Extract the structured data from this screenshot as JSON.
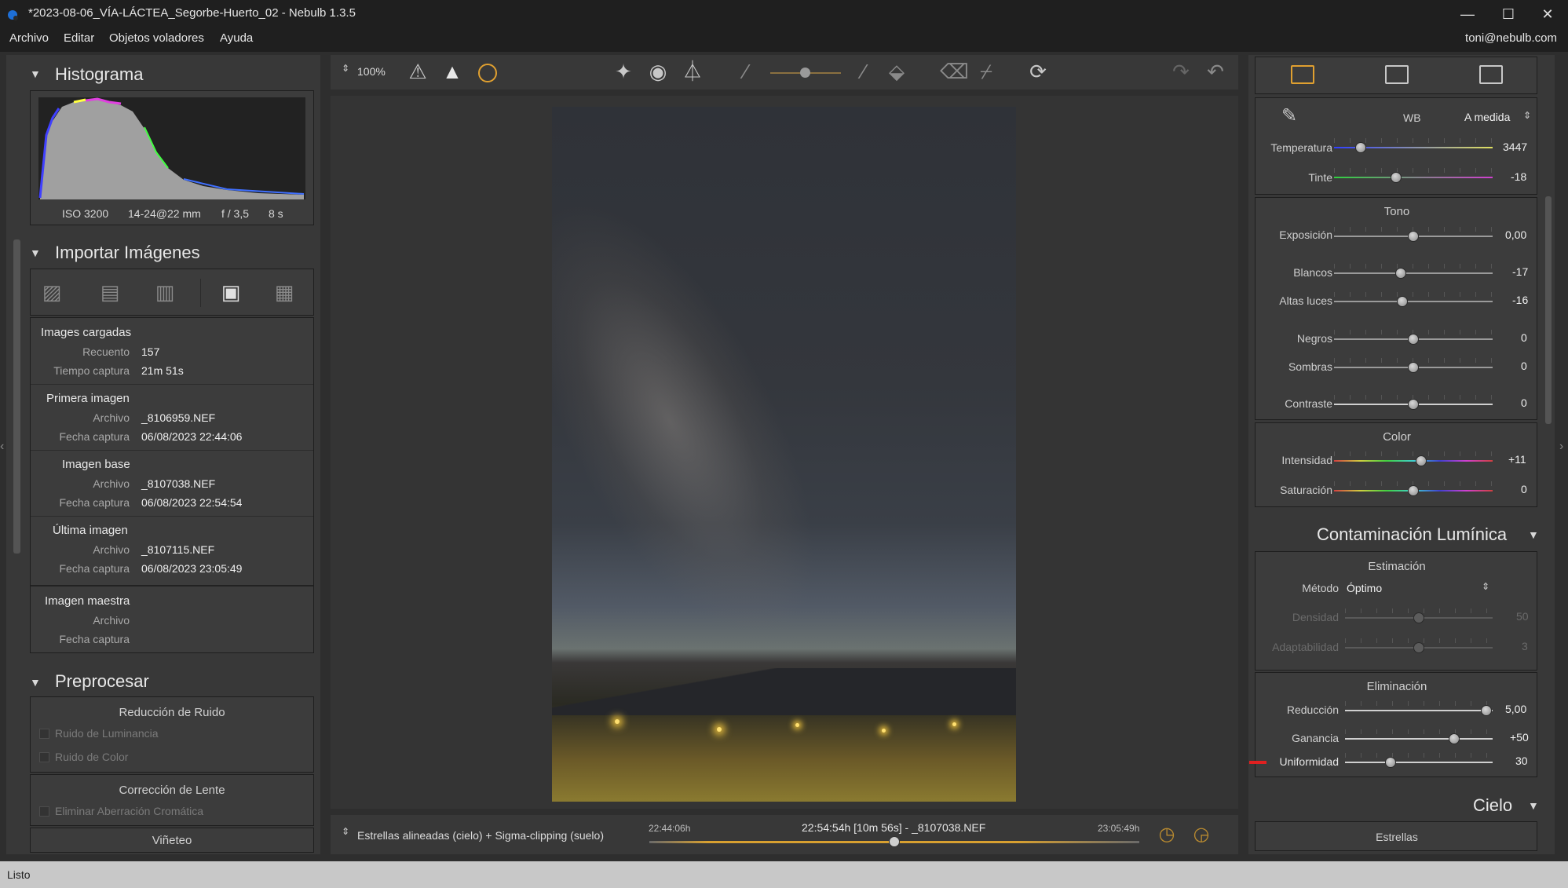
{
  "window": {
    "title": "*2023-08-06_VÍA-LÁCTEA_Segorbe-Huerto_02 - Nebulb 1.3.5",
    "controls": {
      "minimize": "—",
      "maximize": "☐",
      "close": "✕"
    }
  },
  "menu": {
    "items": [
      "Archivo",
      "Editar",
      "Objetos voladores",
      "Ayuda"
    ],
    "user": "toni@nebulb.com"
  },
  "left": {
    "histogram": {
      "title": "Histograma",
      "iso": "ISO 3200",
      "lens": "14-24@22 mm",
      "aperture": "f / 3,5",
      "exposure": "8 s"
    },
    "import": {
      "title": "Importar Imágenes",
      "loaded": {
        "heading": "Images cargadas",
        "count_label": "Recuento",
        "count": "157",
        "time_label": "Tiempo captura",
        "time": "21m 51s"
      },
      "first": {
        "heading": "Primera imagen",
        "file_label": "Archivo",
        "file": "_8106959.NEF",
        "date_label": "Fecha captura",
        "date": "06/08/2023 22:44:06"
      },
      "base": {
        "heading": "Imagen base",
        "file_label": "Archivo",
        "file": "_8107038.NEF",
        "date_label": "Fecha captura",
        "date": "06/08/2023 22:54:54"
      },
      "last": {
        "heading": "Última imagen",
        "file_label": "Archivo",
        "file": "_8107115.NEF",
        "date_label": "Fecha captura",
        "date": "06/08/2023 23:05:49"
      },
      "master": {
        "heading": "Imagen maestra",
        "file_label": "Archivo",
        "date_label": "Fecha captura"
      }
    },
    "preprocess": {
      "title": "Preprocesar",
      "noise_heading": "Reducción de Ruido",
      "luminance": "Ruido de Luminancia",
      "color": "Ruido de Color",
      "lens_heading": "Corrección de Lente",
      "chromatic": "Eliminar Aberración Cromática",
      "vignette": "Viñeteo"
    }
  },
  "toolbar": {
    "zoom": "100%"
  },
  "bottom": {
    "mode": "Estrellas alineadas (cielo) + Sigma-clipping (suelo)",
    "start": "22:44:06h",
    "current": "22:54:54h [10m 56s] - _8107038.NEF",
    "end": "23:05:49h",
    "timeline_position": 0.5
  },
  "right": {
    "wb": {
      "label": "WB",
      "value": "A medida"
    },
    "temperature": {
      "label": "Temperatura",
      "value": "3447",
      "pos": 0.17
    },
    "tint": {
      "label": "Tinte",
      "value": "-18",
      "pos": 0.39
    },
    "tone": {
      "heading": "Tono",
      "exposure": {
        "label": "Exposición",
        "value": "0,00",
        "pos": 0.5
      },
      "whites": {
        "label": "Blancos",
        "value": "-17",
        "pos": 0.42
      },
      "highlights": {
        "label": "Altas luces",
        "value": "-16",
        "pos": 0.43
      },
      "blacks": {
        "label": "Negros",
        "value": "0",
        "pos": 0.5
      },
      "shadows": {
        "label": "Sombras",
        "value": "0",
        "pos": 0.5
      },
      "contrast": {
        "label": "Contraste",
        "value": "0",
        "pos": 0.5
      }
    },
    "color": {
      "heading": "Color",
      "intensity": {
        "label": "Intensidad",
        "value": "+11",
        "pos": 0.55
      },
      "saturation": {
        "label": "Saturación",
        "value": "0",
        "pos": 0.5
      }
    },
    "light_pollution": {
      "title": "Contaminación Lumínica",
      "estimation": "Estimación",
      "method_label": "Método",
      "method": "Óptimo",
      "density": {
        "label": "Densidad",
        "value": "50",
        "pos": 0.5
      },
      "adaptability": {
        "label": "Adaptabilidad",
        "value": "3",
        "pos": 0.5
      },
      "elimination": "Eliminación",
      "reduction": {
        "label": "Reducción",
        "value": "5,00",
        "pos": 0.96
      },
      "gain": {
        "label": "Ganancia",
        "value": "+50",
        "pos": 0.74
      },
      "uniformity": {
        "label": "Uniformidad",
        "value": "30",
        "pos": 0.31
      }
    },
    "sky": {
      "title": "Cielo",
      "stars": "Estrellas"
    }
  },
  "status": "Listo"
}
